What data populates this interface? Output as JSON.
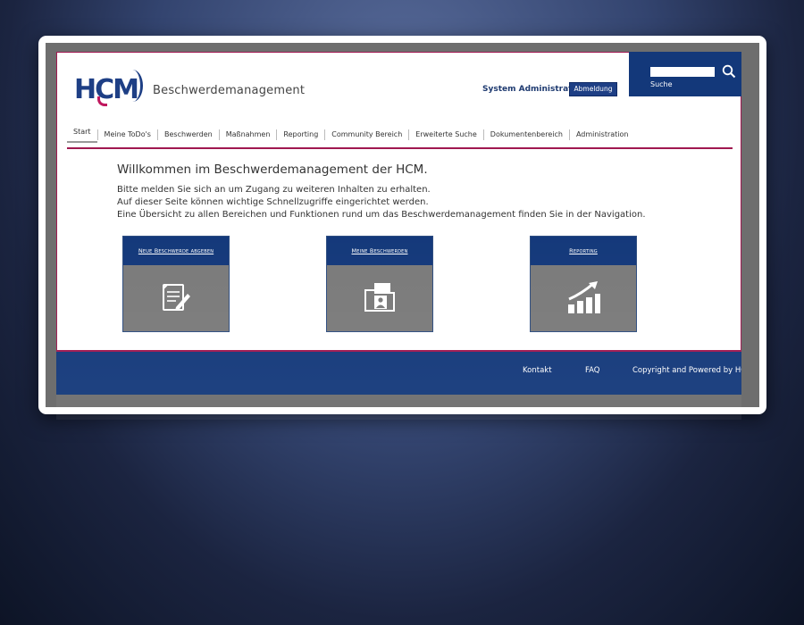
{
  "header": {
    "logo_text": "HCM",
    "app_name": "Beschwerdemanagement",
    "user_name": "System Administrator",
    "logout_label": "Abmeldung",
    "search_label": "Suche",
    "search_value": ""
  },
  "nav": {
    "items": [
      {
        "label": "Start"
      },
      {
        "label": "Meine ToDo's"
      },
      {
        "label": "Beschwerden"
      },
      {
        "label": "Maßnahmen"
      },
      {
        "label": "Reporting"
      },
      {
        "label": "Community Bereich"
      },
      {
        "label": "Erweiterte Suche"
      },
      {
        "label": "Dokumentenbereich"
      },
      {
        "label": "Administration"
      }
    ],
    "active_index": 0
  },
  "welcome": {
    "title": "Willkommen im Beschwerdemanagement der HCM.",
    "lines": [
      "Bitte melden Sie sich an um Zugang zu weiteren Inhalten zu erhalten.",
      "Auf dieser Seite können wichtige Schnellzugriffe eingerichtet werden.",
      "Eine Übersicht zu allen Bereichen und Funktionen rund um das Beschwerdemanagement finden Sie in der Navigation."
    ]
  },
  "tiles": [
    {
      "label": "Neue Beschwerde abgeben",
      "icon": "document-edit-icon"
    },
    {
      "label": "Meine Beschwerden",
      "icon": "folder-person-icon"
    },
    {
      "label": "Reporting",
      "icon": "bar-chart-up-icon"
    }
  ],
  "footer": {
    "contact_label": "Kontakt",
    "faq_label": "FAQ",
    "copyright_label": "Copyright and Powered by HCM"
  },
  "colors": {
    "brand_blue": "#13387a",
    "accent_magenta": "#a01850",
    "tile_gray": "#7a7a7a"
  }
}
